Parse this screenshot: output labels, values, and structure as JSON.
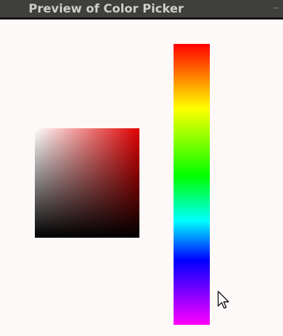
{
  "window": {
    "title": "Preview of Color Picker",
    "titlebar_color": "#3f3f3b",
    "background_color": "#fcf9f8",
    "minimize_icon": "minimize-icon"
  },
  "color_picker": {
    "current_hue_color": "#e00000",
    "hue_gradient_colors": [
      "#ff0000",
      "#ffff00",
      "#00ff00",
      "#00ffff",
      "#0000ff",
      "#ff00ff"
    ]
  },
  "pointer": {
    "icon": "mouse-pointer-icon"
  }
}
